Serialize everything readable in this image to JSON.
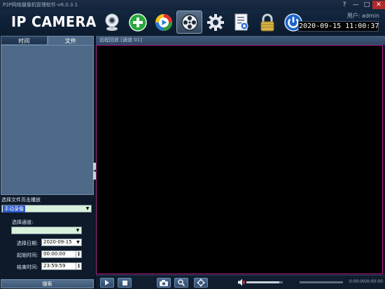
{
  "window": {
    "title": "P2P网络摄像机管理软件-v6.0.3.1",
    "help": "?",
    "minimize": "—",
    "maximize": "□",
    "close": "✕"
  },
  "header": {
    "logo": "IP CAMERA",
    "user_label": "用户: admin",
    "clock": "2020-09-15  11:00:37",
    "toolbar": [
      {
        "name": "camera-icon"
      },
      {
        "name": "add-device-icon"
      },
      {
        "name": "media-player-icon"
      },
      {
        "name": "film-reel-icon",
        "active": true
      },
      {
        "name": "settings-gear-icon"
      },
      {
        "name": "log-document-icon"
      },
      {
        "name": "lock-icon"
      },
      {
        "name": "power-icon"
      }
    ]
  },
  "sidebar": {
    "tabs": [
      {
        "label": "时间"
      },
      {
        "label": "文件"
      }
    ],
    "select_file_label": "选择文件页击播放",
    "record_type": "手动录像",
    "channel_label": "选择通道:",
    "channel_value": "",
    "date_label": "选择日期:",
    "date_value": "2020-09-15",
    "start_label": "起始时间:",
    "start_value": "00:00:00",
    "end_label": "结束时间:",
    "end_value": "23:59:59",
    "search_button": "搜索"
  },
  "video": {
    "header": "远程回放 [通道 01]"
  },
  "controls": {
    "timecode": "0:00:00/0:00:00",
    "volume": 0.9,
    "progress": 0.0,
    "colors": {
      "accent": "#b3268f",
      "panel": "#4e6a88"
    }
  }
}
